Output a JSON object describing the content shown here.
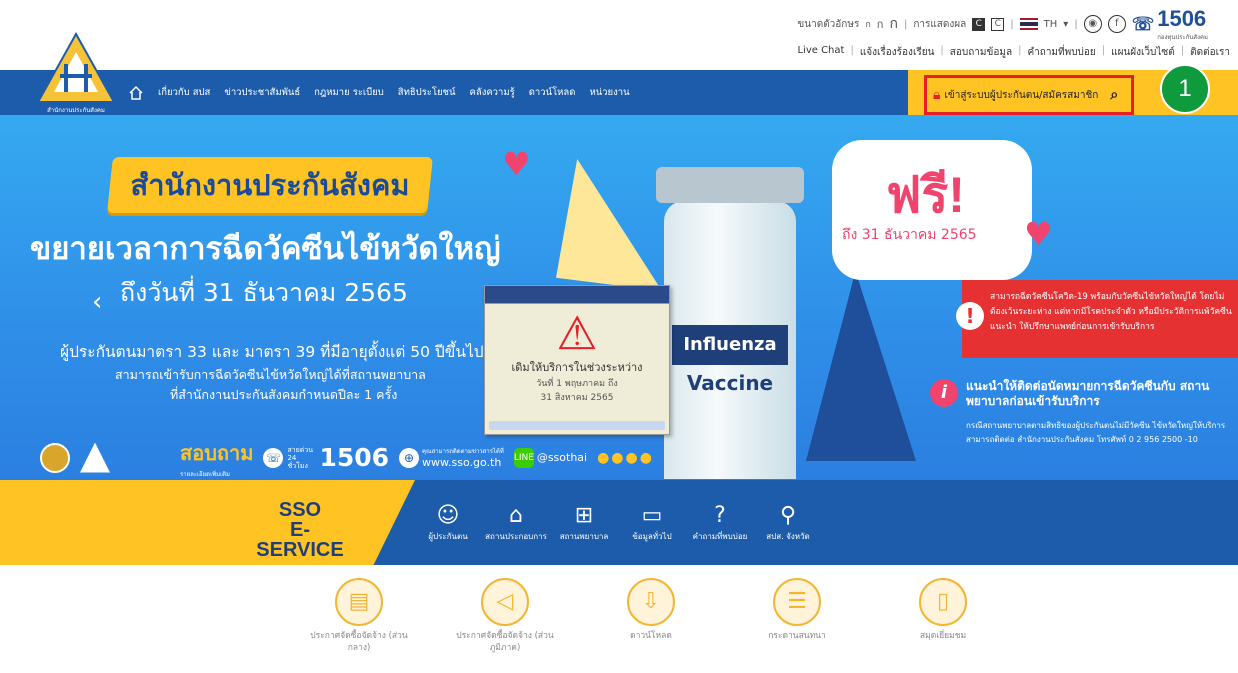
{
  "topbar": {
    "font_size_label": "ขนาดตัวอักษร",
    "font_size_options": [
      "ก",
      "ก",
      "ก"
    ],
    "display_label": "การแสดงผล",
    "contrast_options": [
      "C",
      "C"
    ],
    "lang": "TH",
    "hotline_number": "1506",
    "hotline_caption": "กองทุนประกันสังคม",
    "links": [
      "Live Chat",
      "แจ้งเรื่องร้องเรียน",
      "สอบถามข้อมูล",
      "คำถามที่พบบ่อย",
      "แผนผังเว็บไซต์",
      "ติดต่อเรา"
    ]
  },
  "logo": {
    "caption": "สำนักงานประกันสังคม"
  },
  "nav": {
    "items": [
      "เกี่ยวกับ สปส",
      "ข่าวประชาสัมพันธ์",
      "กฎหมาย ระเบียบ",
      "สิทธิประโยชน์",
      "คลังความรู้",
      "ดาวน์โหลด",
      "หน่วยงาน"
    ],
    "login_label": "เข้าสู่ระบบผู้ประกันตน/สมัครสมาชิก"
  },
  "step_marker": "1",
  "hero": {
    "badge": "สำนักงานประกันสังคม",
    "title": "ขยายเวลาการฉีดวัคซีนไข้หวัดใหญ่",
    "subtitle": "ถึงวันที่ 31 ธันวาคม 2565",
    "line1": "ผู้ประกันตนมาตรา 33 และ มาตรา 39 ที่มีอายุตั้งแต่ 50 ปีขึ้นไป",
    "line2": "สามารถเข้ารับการฉีดวัคซีนไข้หวัดใหญ่ได้ที่สถานพยาบาล",
    "line3": "ที่สำนักงานประกันสังคมกำหนดปีละ 1 ครั้ง",
    "popup_title": "เดิมให้บริการในช่วงระหว่าง",
    "popup_date1": "วันที่ 1 พฤษภาคม ถึง",
    "popup_date2": "31 สิงหาคม 2565",
    "bottle_label": "Influenza",
    "bottle_sub": "Vaccine",
    "free": "ฟรี!",
    "free_until": "ถึง 31 ธันวาคม 2565",
    "red_note": "สามารถฉีดวัคซีนโควิด-19 พร้อมกับวัคซีนไข้หวัดใหญ่ได้ โดยไม่ต้องเว้นระยะห่าง แต่หากมีโรคประจำตัว หรือมีประวัติการแพ้วัคซีน แนะนำ ให้ปรึกษาแพทย์ก่อนการเข้ารับบริการ",
    "info_title": "แนะนำให้ติดต่อนัดหมายการฉีดวัคซีนกับ สถานพยาบาลก่อนเข้ารับบริการ",
    "info_body": "กรณีสถานพยาบาลตามสิทธิของผู้ประกันตนไม่มีวัคซีน ไข้หวัดใหญ่ให้บริการ สามารถติดต่อ สำนักงานประกันสังคม โทรศัพท์ 0 2 956 2500 -10",
    "ask": "สอบถาม",
    "ask_sub": "รายละเอียดเพิ่มเติม",
    "hotline_small": "สายด่วน 24 ชั่วโมง",
    "hotline": "1506",
    "web_small": "คุณสามารถติดตามข่าวสารได้ที่",
    "web": "www.sso.go.th",
    "line_id": "@ssothai"
  },
  "service": {
    "title1": "SSO",
    "title2": "E-SERVICE",
    "items": [
      {
        "label": "ผู้ประกันตน",
        "icon": "person-icon"
      },
      {
        "label": "สถานประกอบการ",
        "icon": "building-icon"
      },
      {
        "label": "สถานพยาบาล",
        "icon": "hospital-icon"
      },
      {
        "label": "ข้อมูลทั่วไป",
        "icon": "folder-icon"
      },
      {
        "label": "คำถามที่พบบ่อย",
        "icon": "question-icon"
      },
      {
        "label": "สปส. จังหวัด",
        "icon": "map-pin-icon"
      }
    ]
  },
  "bottom": {
    "items": [
      {
        "label": "ประกาศจัดซื้อจัดจ้าง (ส่วนกลาง)",
        "icon": "document-icon"
      },
      {
        "label": "ประกาศจัดซื้อจัดจ้าง (ส่วนภูมิภาค)",
        "icon": "megaphone-icon"
      },
      {
        "label": "ดาวน์โหลด",
        "icon": "download-icon"
      },
      {
        "label": "กระดานสนทนา",
        "icon": "chat-icon"
      },
      {
        "label": "สมุดเยี่ยมชม",
        "icon": "book-icon"
      }
    ]
  }
}
